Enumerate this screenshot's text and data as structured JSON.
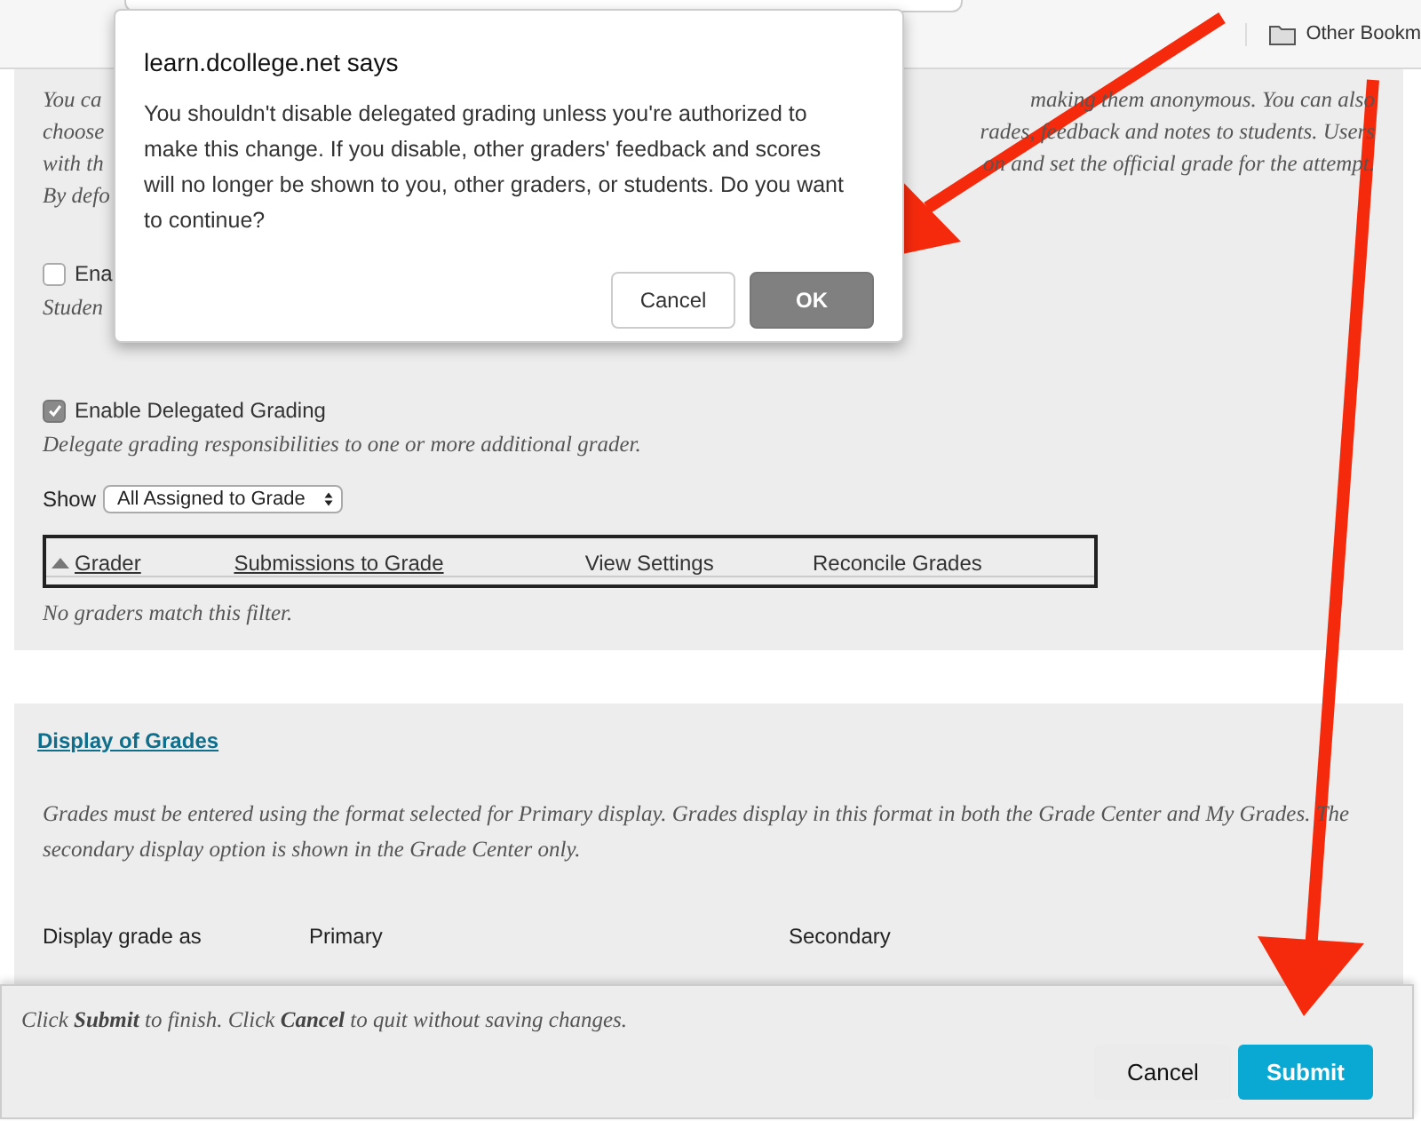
{
  "bookmarks_bar": {
    "folder": "Other Bookm"
  },
  "grading_section": {
    "intro_lines": [
      {
        "left": "You ca",
        "right": "making them anonymous. You can also"
      },
      {
        "left": "choose",
        "right": "rades, feedback and notes to students. Users"
      },
      {
        "left": "with th",
        "right": "on and set the official grade for the attempt."
      },
      {
        "left": "By defo"
      }
    ],
    "options": [
      {
        "label": "Ena",
        "checked": false,
        "hint": "Studen"
      },
      {
        "label": "Enable Delegated Grading",
        "checked": true,
        "hint": "Delegate grading responsibilities to one or more additional grader."
      }
    ],
    "filter": {
      "label": "Show",
      "value": "All Assigned to Grade"
    },
    "table": {
      "columns": [
        {
          "label": "Grader",
          "link": true,
          "sorted": true
        },
        {
          "label": "Submissions to Grade",
          "link": true,
          "sorted": false
        },
        {
          "label": "View Settings",
          "link": false,
          "sorted": false
        },
        {
          "label": "Reconcile Grades",
          "link": false,
          "sorted": false
        }
      ],
      "empty": "No graders match this filter."
    }
  },
  "display_section": {
    "title": "Display of Grades",
    "text": "Grades must be entered using the format selected for Primary display. Grades display in this format in both the Grade Center and My Grades. The secondary display option is shown in the Grade Center only.",
    "columns": [
      "Display grade as",
      "Primary",
      "Secondary"
    ]
  },
  "footer": {
    "text": "Click **Submit** to finish. Click **Cancel** to quit without saving changes.",
    "buttons": [
      {
        "label": "Cancel",
        "primary": false
      },
      {
        "label": "Submit",
        "primary": true
      }
    ]
  },
  "dialog": {
    "title": "learn.dcollege.net says",
    "message": "You shouldn't disable delegated grading unless you're authorized to make this change. If you disable, other graders' feedback and scores will no longer be shown to you, other graders, or students. Do you want to continue?",
    "buttons": [
      {
        "label": "Cancel",
        "primary": false
      },
      {
        "label": "OK",
        "primary": true
      }
    ]
  }
}
